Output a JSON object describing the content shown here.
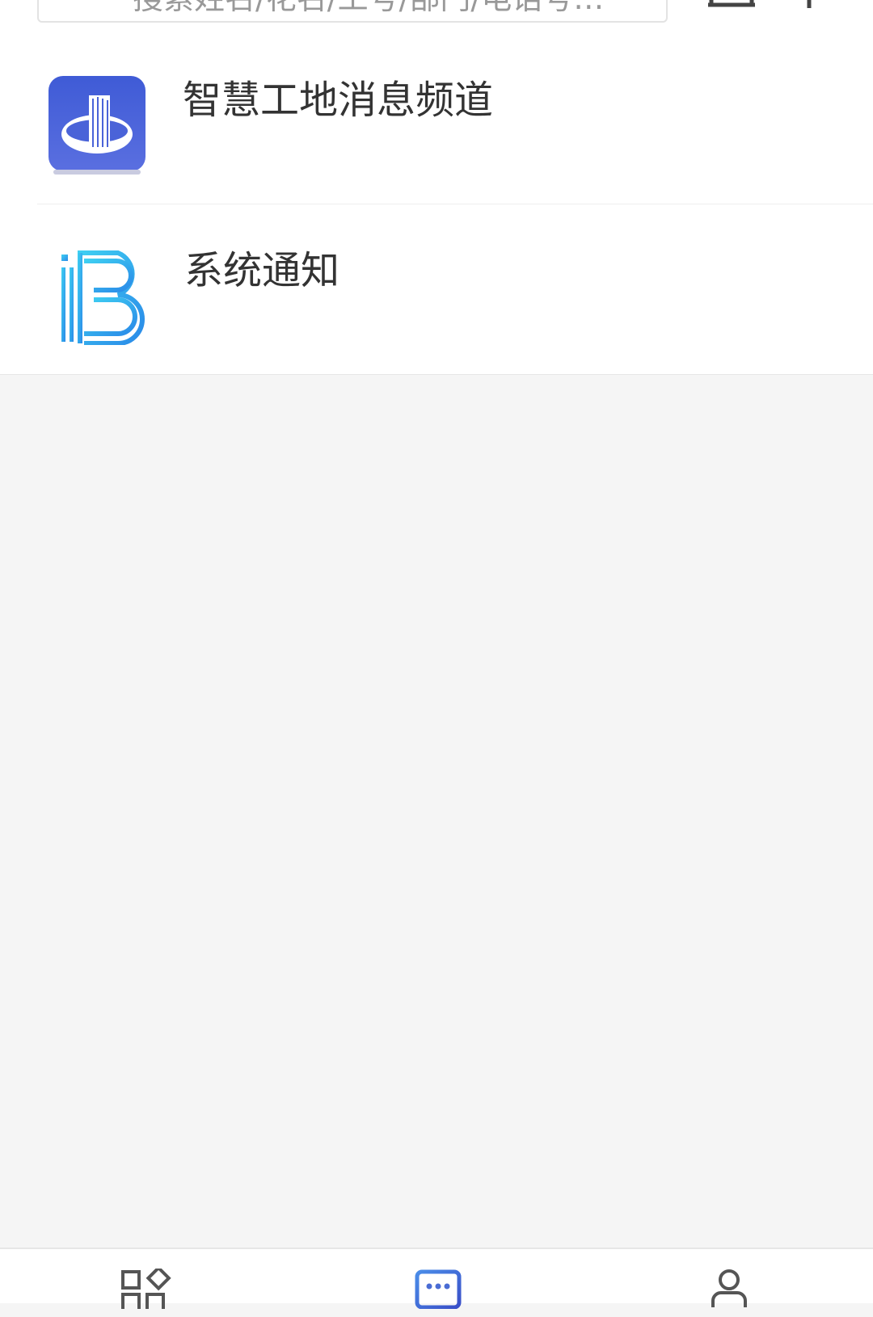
{
  "search": {
    "placeholder": "搜索姓名/花名/工号/部门/电话号…",
    "icon": "search-icon"
  },
  "header_actions": {
    "scan_icon": "scan-icon",
    "add_icon": "plus-icon"
  },
  "messages": [
    {
      "title": "智慧工地消息频道",
      "icon": "building-app-logo"
    },
    {
      "title": "系统通知",
      "icon": "ib-logo"
    }
  ],
  "bottom_nav": {
    "active_color": "#4a6cd4",
    "inactive_color": "#555555",
    "items": [
      {
        "icon": "apps-grid-icon",
        "active": false
      },
      {
        "icon": "chat-bubble-icon",
        "active": true
      },
      {
        "icon": "user-icon",
        "active": false
      }
    ]
  }
}
